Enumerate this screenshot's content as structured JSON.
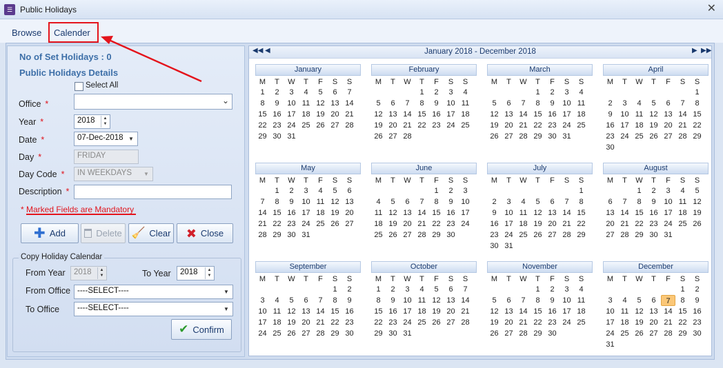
{
  "window": {
    "title": "Public Holidays"
  },
  "tabs": [
    {
      "label": "Browse"
    },
    {
      "label": "Calender"
    }
  ],
  "form": {
    "count_label": "No of Set Holidays : 0",
    "section_title": "Public Holidays Details",
    "select_all_label": "Select All",
    "office_label": "Office",
    "office_value": "",
    "year_label": "Year",
    "year_value": "2018",
    "date_label": "Date",
    "date_value": "07-Dec-2018",
    "day_label": "Day",
    "day_value": "FRIDAY",
    "daycode_label": "Day Code",
    "daycode_value": "IN WEEKDAYS",
    "description_label": "Description",
    "description_value": "",
    "required_marker": "*",
    "mandatory_note": "* Marked Fields are Mandatory"
  },
  "buttons": {
    "add": "Add",
    "delete": "Delete",
    "clear": "Clear",
    "close": "Close",
    "confirm": "Confirm"
  },
  "copy": {
    "title": "Copy Holiday Calendar",
    "from_year_label": "From Year",
    "from_year_value": "2018",
    "to_year_label": "To Year",
    "to_year_value": "2018",
    "from_office_label": "From Office",
    "from_office_value": "----SELECT----",
    "to_office_label": "To Office",
    "to_office_value": "----SELECT----"
  },
  "calendar": {
    "range_label": "January 2018 - December 2018",
    "weekday_headers": [
      "M",
      "T",
      "W",
      "T",
      "F",
      "S",
      "S"
    ],
    "highlighted": {
      "month": 11,
      "day": 7
    },
    "months": [
      {
        "name": "January",
        "offset": 0,
        "days": 31
      },
      {
        "name": "February",
        "offset": 3,
        "days": 28
      },
      {
        "name": "March",
        "offset": 3,
        "days": 31
      },
      {
        "name": "April",
        "offset": 6,
        "days": 30
      },
      {
        "name": "May",
        "offset": 1,
        "days": 31
      },
      {
        "name": "June",
        "offset": 4,
        "days": 30
      },
      {
        "name": "July",
        "offset": 6,
        "days": 31
      },
      {
        "name": "August",
        "offset": 2,
        "days": 31
      },
      {
        "name": "September",
        "offset": 5,
        "days": 30
      },
      {
        "name": "October",
        "offset": 0,
        "days": 31
      },
      {
        "name": "November",
        "offset": 3,
        "days": 30
      },
      {
        "name": "December",
        "offset": 5,
        "days": 31
      }
    ]
  },
  "colors": {
    "accent": "#3d6fa8",
    "required": "#e0141c",
    "highlight_day": "#fbc777"
  }
}
